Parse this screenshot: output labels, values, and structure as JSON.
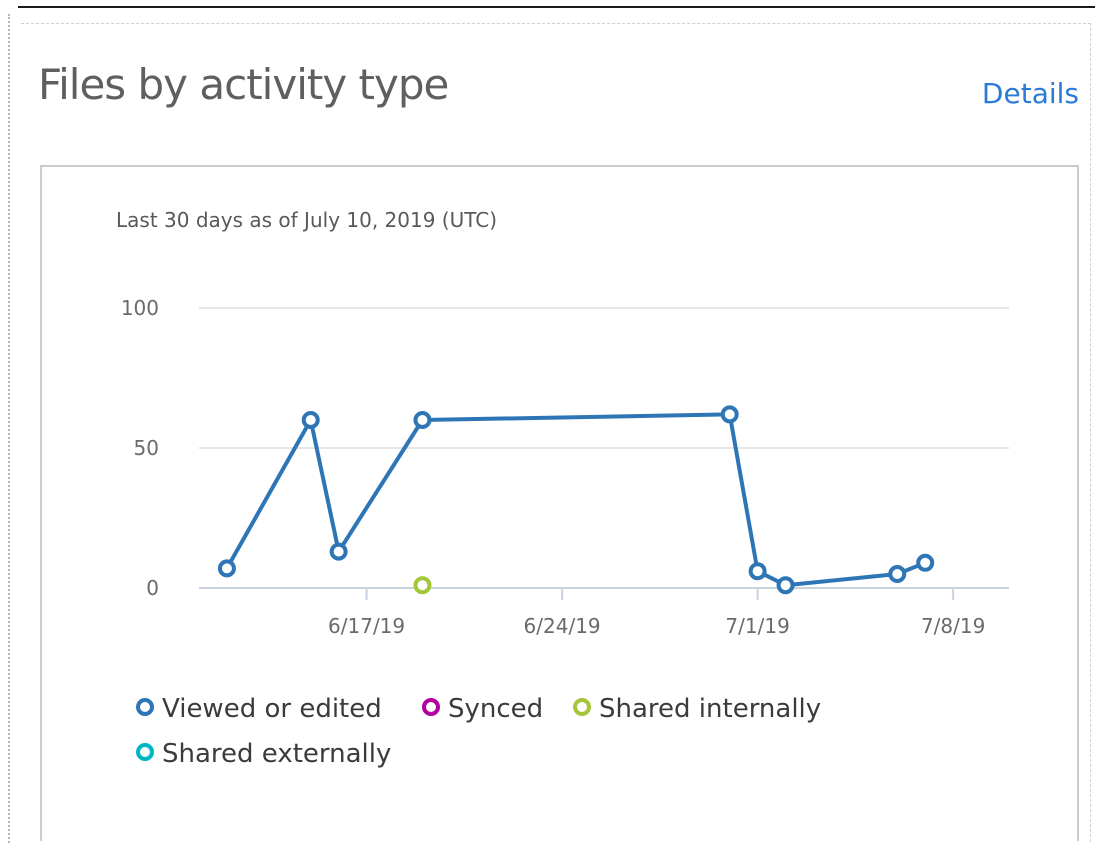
{
  "card": {
    "title": "Files by activity type",
    "details_label": "Details"
  },
  "chart_data": {
    "type": "line",
    "subtitle": "Last 30 days as of July 10, 2019 (UTC)",
    "y_ticks": [
      0,
      50,
      100
    ],
    "ylim": [
      0,
      100
    ],
    "x_ticks": [
      {
        "label": "6/17/19",
        "date": "2019-06-17"
      },
      {
        "label": "6/24/19",
        "date": "2019-06-24"
      },
      {
        "label": "7/1/19",
        "date": "2019-07-01"
      },
      {
        "label": "7/8/19",
        "date": "2019-07-08"
      }
    ],
    "xlim": [
      "2019-06-11",
      "2019-07-10"
    ],
    "grid": true,
    "legend_position": "bottom-left",
    "series": [
      {
        "name": "Viewed or edited",
        "color": "#2e75b6",
        "points": [
          {
            "x": "2019-06-12",
            "y": 7
          },
          {
            "x": "2019-06-15",
            "y": 60
          },
          {
            "x": "2019-06-16",
            "y": 13
          },
          {
            "x": "2019-06-19",
            "y": 60
          },
          {
            "x": "2019-06-30",
            "y": 62
          },
          {
            "x": "2019-07-01",
            "y": 6
          },
          {
            "x": "2019-07-02",
            "y": 1
          },
          {
            "x": "2019-07-06",
            "y": 5
          },
          {
            "x": "2019-07-07",
            "y": 9
          }
        ]
      },
      {
        "name": "Synced",
        "color": "#b4009e",
        "points": []
      },
      {
        "name": "Shared internally",
        "color": "#a4c639",
        "points": [
          {
            "x": "2019-06-19",
            "y": 1
          }
        ]
      },
      {
        "name": "Shared externally",
        "color": "#00b7c3",
        "points": []
      }
    ]
  }
}
